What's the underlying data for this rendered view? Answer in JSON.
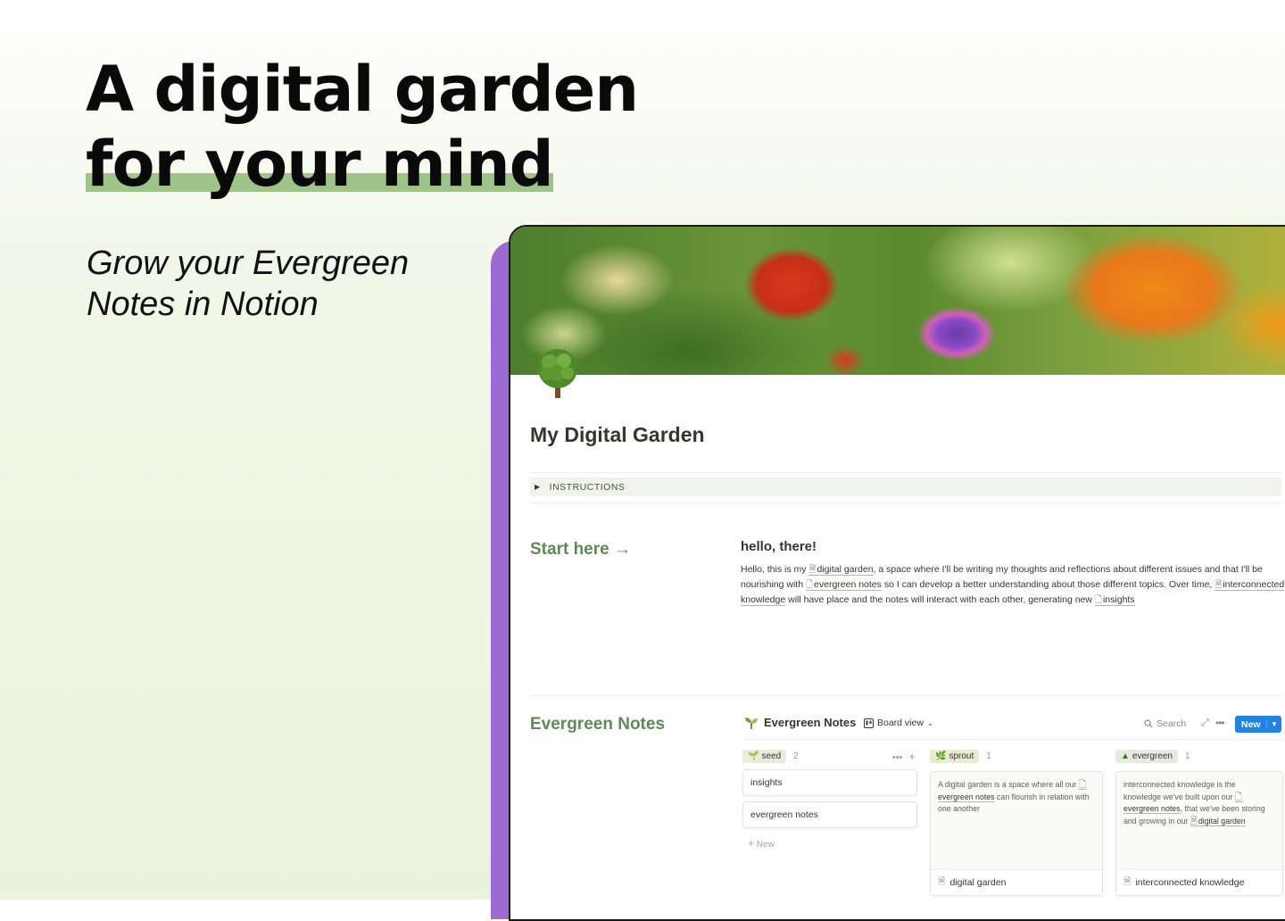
{
  "hero": {
    "title_line1": "A digital garden",
    "title_line2": "for your mind",
    "subtitle_line1": "Grow your Evergreen",
    "subtitle_line2": "Notes in Notion"
  },
  "colors": {
    "accent_green": "#9ec48a",
    "purple_bar": "#9b6bd3",
    "section_green": "#5d8a55",
    "new_button": "#2383e2"
  },
  "page": {
    "title": "My Digital Garden",
    "toggle_label": "INSTRUCTIONS",
    "start_label": "Start here →",
    "hello_heading": "hello, there!",
    "hello_parts": {
      "p1": "Hello, this is my ",
      "m1": "digital garden",
      "p2": ", a space where I'll be writing my thoughts and reflections about different issues and that I'll be nourishing with ",
      "m2": "evergreen notes",
      "p3": " so I can develop a better understanding about those different topics. Over time, ",
      "m3": "interconnected knowledge",
      "p4": " will have place and the notes will interact with each other, generating new ",
      "m4": "insights"
    },
    "evergreen_label": "Evergreen Notes"
  },
  "board": {
    "title": "Evergreen Notes",
    "view": "Board view",
    "search": "Search",
    "new_button": "New",
    "columns": [
      {
        "tag": "seed",
        "count": "2",
        "tag_color": "#eaeadf",
        "cards": [
          "insights",
          "evergreen notes"
        ],
        "add_label": "New"
      },
      {
        "tag": "sprout",
        "count": "1",
        "tag_color": "#e9ecd0",
        "preview_a": "A digital garden is a space where all our ",
        "preview_m": "evergreen notes",
        "preview_b": " can flourish in relation with one another",
        "card_title": "digital garden"
      },
      {
        "tag": "evergreen",
        "count": "1",
        "tag_color": "#e6eadf",
        "preview_a": "interconnected knowledge is the knowledge we've built upon our ",
        "preview_m": "evergreen notes",
        "preview_b": ", that we've been storing and growing in our ",
        "preview_m2": "digital garden",
        "card_title": "interconnected knowledge"
      }
    ]
  }
}
